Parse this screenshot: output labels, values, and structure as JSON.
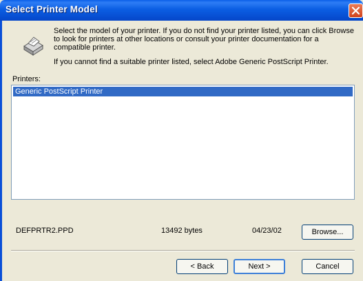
{
  "window": {
    "title": "Select Printer Model",
    "close_icon": "close-icon"
  },
  "instructions": {
    "line1": "Select the model of your printer. If you do not find your printer listed, you can click Browse to look for printers at other locations or consult your printer documentation for a compatible printer.",
    "line2": "If you cannot find a suitable printer listed, select Adobe Generic PostScript Printer."
  },
  "printers": {
    "label": "Printers:",
    "items": [
      "Generic PostScript Printer"
    ],
    "selected": "Generic PostScript Printer"
  },
  "file_info": {
    "filename": "DEFPRTR2.PPD",
    "size": "13492 bytes",
    "date": "04/23/02"
  },
  "buttons": {
    "browse": "Browse...",
    "back": "< Back",
    "next": "Next >",
    "cancel": "Cancel"
  },
  "colors": {
    "title_bar": "#0a5fe8",
    "selection": "#316ac5",
    "dialog_bg": "#ece9d8"
  }
}
